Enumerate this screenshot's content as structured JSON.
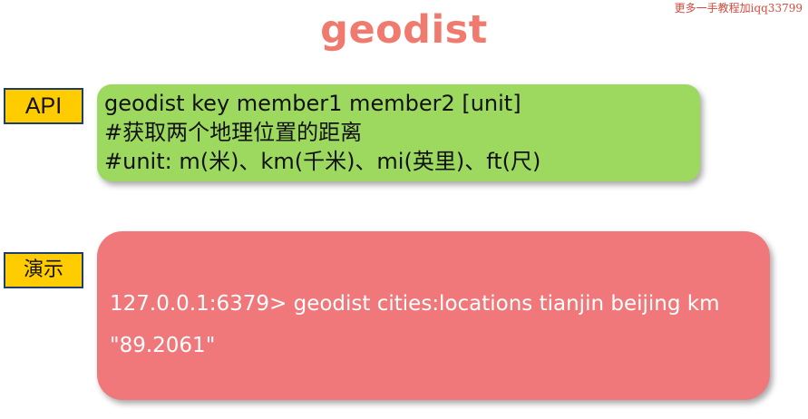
{
  "watermark": "更多一手教程加iqq33799",
  "title": "geodist",
  "api_section": {
    "tag_label": "API",
    "lines": [
      "geodist key member1 member2 [unit]",
      "#获取两个地理位置的距离",
      "#unit: m(米)、km(千米)、mi(英里)、ft(尺)"
    ]
  },
  "demo_section": {
    "tag_label": "演示",
    "lines": [
      "127.0.0.1:6379> geodist cities:locations tianjin beijing km",
      "\"89.2061\""
    ]
  },
  "colors": {
    "title": "#f07a6e",
    "tag_fill": "#ffcc00",
    "tag_border": "#1e3f6e",
    "api_box": "#9ed95f",
    "demo_box": "#f0787a",
    "watermark": "#d24a3c"
  }
}
